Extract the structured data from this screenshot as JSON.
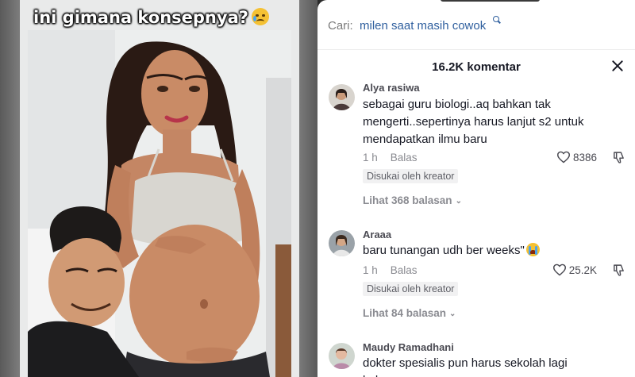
{
  "video": {
    "caption": "ini gimana konsepnya?",
    "caption_emoji_icon": "crying-face-emoji"
  },
  "search": {
    "prefix": "Cari:",
    "query": "milen saat masih cowok"
  },
  "comments_header": {
    "count_label": "16.2K komentar"
  },
  "comments": [
    {
      "username": "Alya rasiwa",
      "text": "sebagai guru biologi..aq bahkan tak mengerti..sepertinya harus lanjut s2 untuk mendapatkan ilmu baru",
      "time": "1 h",
      "reply_label": "Balas",
      "likes": "8386",
      "creator_badge": "Disukai oleh kreator",
      "view_replies": "Lihat 368 balasan"
    },
    {
      "username": "Araaa",
      "text": "baru tunangan udh ber weeks\"",
      "time": "1 h",
      "reply_label": "Balas",
      "likes": "25.2K",
      "creator_badge": "Disukai oleh kreator",
      "view_replies": "Lihat 84 balasan"
    },
    {
      "username": "Maudy Ramadhani",
      "text": "dokter spesialis pun harus sekolah lagi keknya"
    }
  ],
  "colors": {
    "search_query": "#2f5f9e",
    "text_primary": "#161823",
    "text_secondary": "#8a8b91"
  }
}
